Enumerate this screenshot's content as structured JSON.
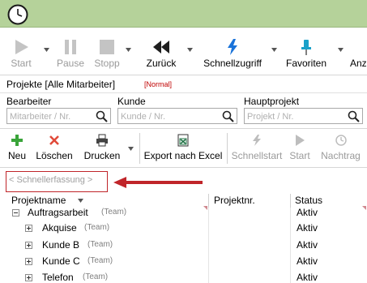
{
  "toolbar": {
    "start": "Start",
    "pause": "Pause",
    "stop": "Stopp",
    "back": "Zurück",
    "quick_access": "Schnellzugriff",
    "favorites": "Favoriten",
    "more": "Anz"
  },
  "project_header": {
    "title": "Projekte [Alle Mitarbeiter]",
    "mode": "[Normal]"
  },
  "filters": {
    "employee_label": "Bearbeiter",
    "employee_placeholder": "Mitarbeiter / Nr.",
    "customer_label": "Kunde",
    "customer_placeholder": "Kunde / Nr.",
    "main_project_label": "Hauptprojekt",
    "main_project_placeholder": "Projekt / Nr."
  },
  "actions": {
    "new": "Neu",
    "delete": "Löschen",
    "print": "Drucken",
    "export_excel": "Export nach Excel",
    "quick_start": "Schnellstart",
    "start": "Start",
    "follow_up": "Nachtrag"
  },
  "quick_entry": {
    "label": "< Schnellerfassung >"
  },
  "grid": {
    "columns": [
      "Projektname",
      "Projektnr.",
      "Status"
    ],
    "rows": [
      {
        "name": "Auftragsarbeit",
        "team": "(Team)",
        "status": "Aktiv",
        "level": 0,
        "expanded": true
      },
      {
        "name": "Akquise",
        "team": "(Team)",
        "status": "Aktiv",
        "level": 1,
        "expanded": false
      },
      {
        "name": "Kunde B",
        "team": "(Team)",
        "status": "Aktiv",
        "level": 1,
        "expanded": false
      },
      {
        "name": "Kunde C",
        "team": "(Team)",
        "status": "Aktiv",
        "level": 1,
        "expanded": false
      },
      {
        "name": "Telefon",
        "team": "(Team)",
        "status": "Aktiv",
        "level": 1,
        "expanded": false
      }
    ]
  },
  "colors": {
    "titlebar": "#b5d29a",
    "accent_red": "#c0252a",
    "mode_red": "#c00000"
  },
  "icons": {
    "clock": "clock-icon",
    "start": "play-icon",
    "pause": "pause-icon",
    "stop": "stop-icon",
    "back": "rewind-icon",
    "quick_access": "lightning-icon",
    "favorites": "pin-icon",
    "new": "plus-icon",
    "delete": "x-icon",
    "print": "printer-icon",
    "export_excel": "excel-icon",
    "quick_start": "lightning-icon",
    "start_action": "play-icon",
    "follow_up": "clock-icon"
  }
}
